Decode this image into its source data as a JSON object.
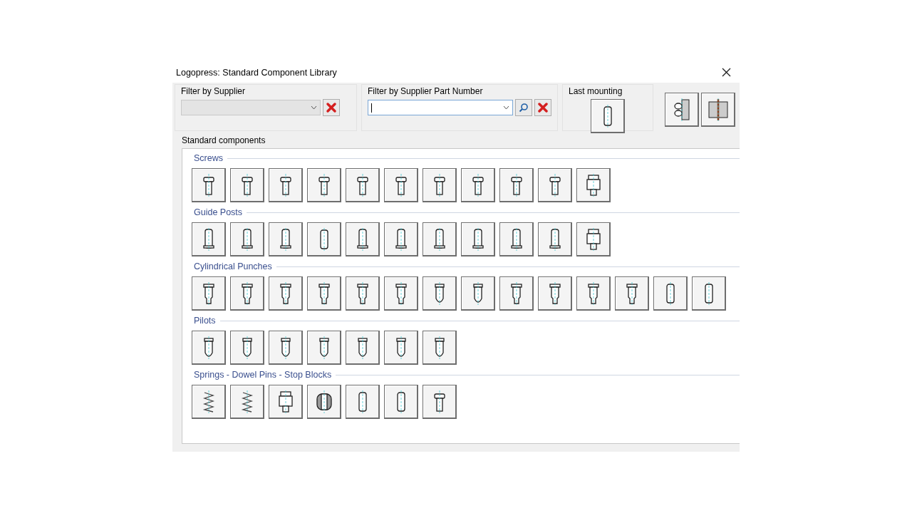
{
  "window": {
    "title": "Logopress: Standard Component Library"
  },
  "filters": [
    {
      "label": "Filter by Supplier",
      "disabled": true,
      "focused": false,
      "search": false
    },
    {
      "label": "Filter by Supplier Part Number",
      "disabled": false,
      "focused": true,
      "search": true
    }
  ],
  "last_mounting": {
    "label": "Last mounting",
    "kind": "dowel"
  },
  "mounting_buttons": [
    {
      "kind": "plate-screw"
    },
    {
      "kind": "plate-post"
    }
  ],
  "library": {
    "label": "Standard components",
    "sections": [
      {
        "title": "Screws",
        "items": [
          {
            "kind": "screw"
          },
          {
            "kind": "screw"
          },
          {
            "kind": "screw"
          },
          {
            "kind": "screw"
          },
          {
            "kind": "screw"
          },
          {
            "kind": "screw"
          },
          {
            "kind": "screw"
          },
          {
            "kind": "screw"
          },
          {
            "kind": "screw"
          },
          {
            "kind": "screw"
          },
          {
            "kind": "block"
          }
        ]
      },
      {
        "title": "Guide Posts",
        "items": [
          {
            "kind": "post"
          },
          {
            "kind": "post"
          },
          {
            "kind": "post"
          },
          {
            "kind": "dowel"
          },
          {
            "kind": "post"
          },
          {
            "kind": "post"
          },
          {
            "kind": "post"
          },
          {
            "kind": "post"
          },
          {
            "kind": "post"
          },
          {
            "kind": "post"
          },
          {
            "kind": "block"
          }
        ]
      },
      {
        "title": "Cylindrical Punches",
        "items": [
          {
            "kind": "punch"
          },
          {
            "kind": "punch"
          },
          {
            "kind": "punch"
          },
          {
            "kind": "punch"
          },
          {
            "kind": "punch"
          },
          {
            "kind": "punch"
          },
          {
            "kind": "pilot"
          },
          {
            "kind": "pilot"
          },
          {
            "kind": "punch"
          },
          {
            "kind": "punch"
          },
          {
            "kind": "punch"
          },
          {
            "kind": "punch"
          },
          {
            "kind": "dowel"
          },
          {
            "kind": "dowel"
          }
        ]
      },
      {
        "title": "Pilots",
        "items": [
          {
            "kind": "pilot"
          },
          {
            "kind": "pilot"
          },
          {
            "kind": "pilot"
          },
          {
            "kind": "pilot"
          },
          {
            "kind": "pilot"
          },
          {
            "kind": "pilot"
          },
          {
            "kind": "pilot"
          }
        ]
      },
      {
        "title": "Springs - Dowel Pins - Stop Blocks",
        "items": [
          {
            "kind": "spring"
          },
          {
            "kind": "spring"
          },
          {
            "kind": "block"
          },
          {
            "kind": "barrel"
          },
          {
            "kind": "dowel"
          },
          {
            "kind": "dowel"
          },
          {
            "kind": "screw"
          }
        ]
      }
    ]
  }
}
